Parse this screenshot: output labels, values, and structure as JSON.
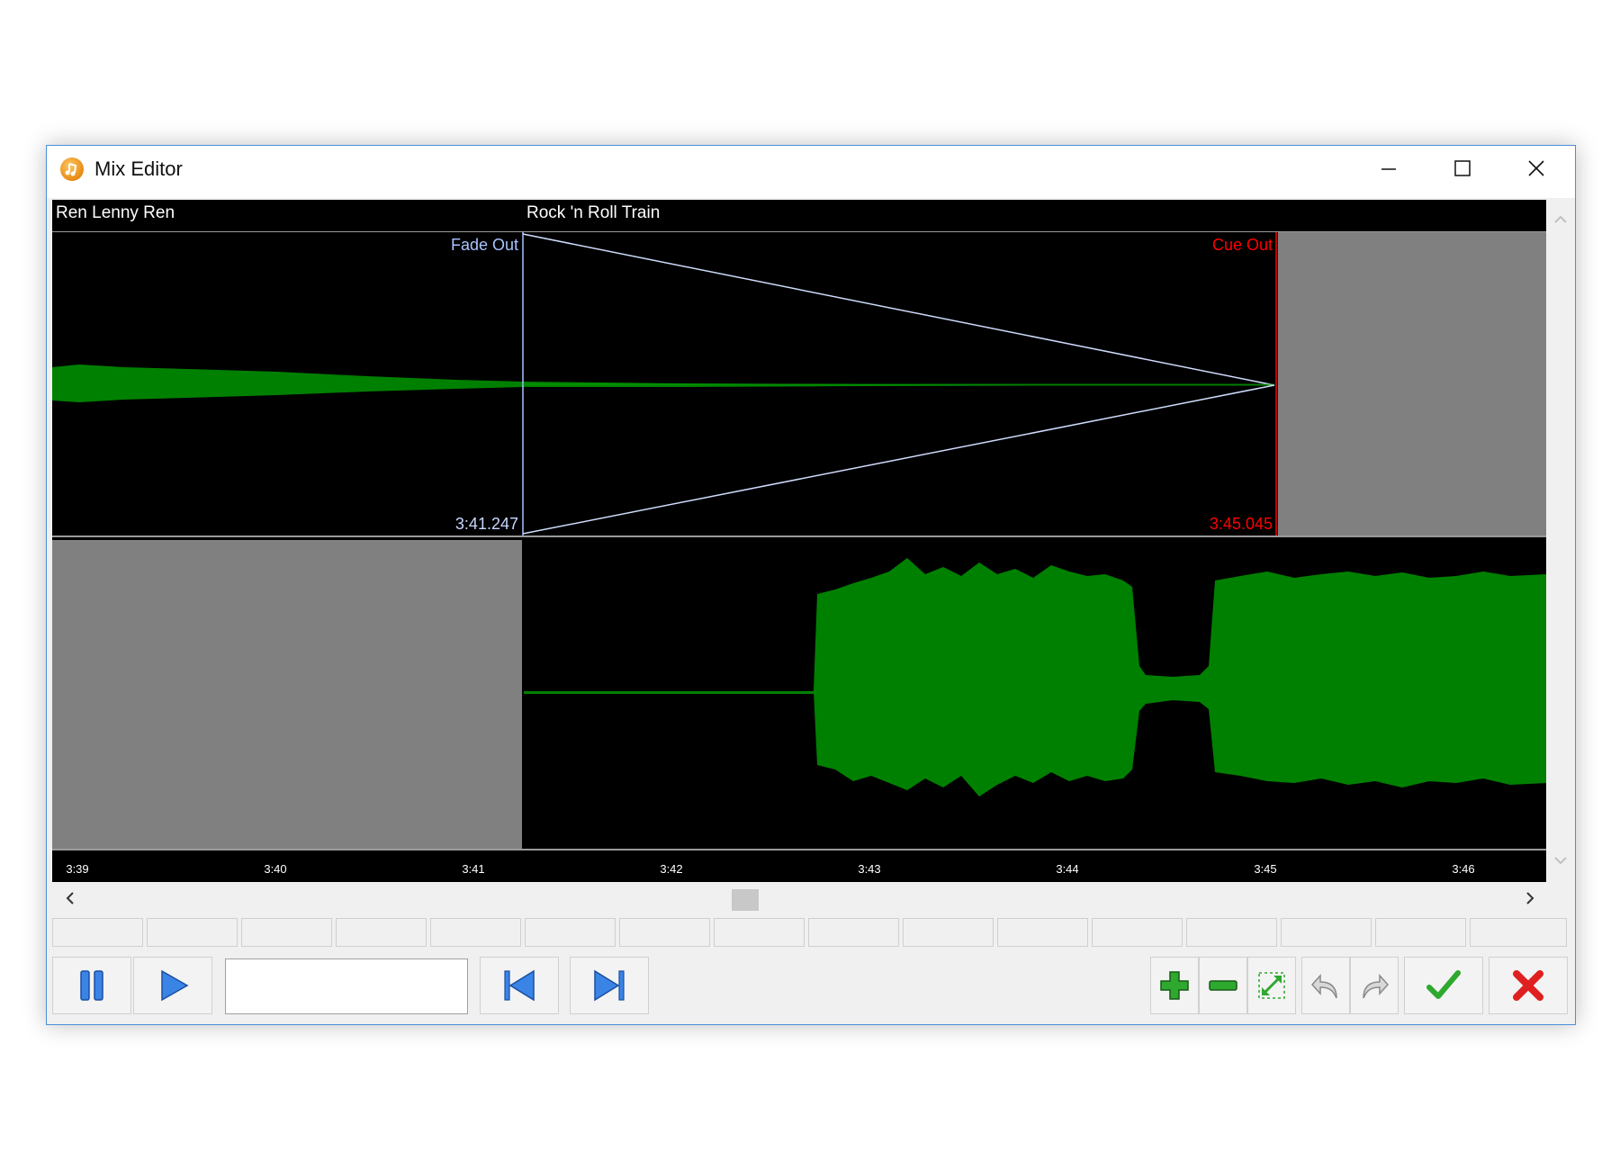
{
  "window": {
    "title": "Mix Editor",
    "controls": {
      "minimize": "minimize-icon",
      "maximize": "maximize-icon",
      "close": "close-icon"
    }
  },
  "tracks": {
    "outgoing": {
      "title": "Ren Lenny Ren",
      "waveform_color": "#008000"
    },
    "incoming": {
      "title": "Rock 'n Roll Train",
      "waveform_color": "#008000"
    }
  },
  "markers": {
    "fade_out": {
      "label": "Fade Out",
      "time": "3:41.247",
      "color": "#a8c4ff"
    },
    "cue_out": {
      "label": "Cue Out",
      "time": "3:45.045",
      "color": "#ff0000"
    }
  },
  "timeline": {
    "ticks": [
      "3:39",
      "3:40",
      "3:41",
      "3:42",
      "3:43",
      "3:44",
      "3:45",
      "3:46"
    ]
  },
  "transport": {
    "time_field_value": "",
    "buttons": [
      "pause-icon",
      "play-icon",
      "skip-back-icon",
      "skip-forward-icon"
    ]
  },
  "edit_tools": {
    "buttons": [
      "zoom-in-icon",
      "zoom-out-icon",
      "zoom-fit-icon",
      "undo-icon",
      "redo-icon",
      "confirm-icon",
      "cancel-icon"
    ]
  },
  "colors": {
    "accent_border": "#4a90d9",
    "fade_line": "#a8c4ff",
    "cue_line": "#ff0000"
  }
}
